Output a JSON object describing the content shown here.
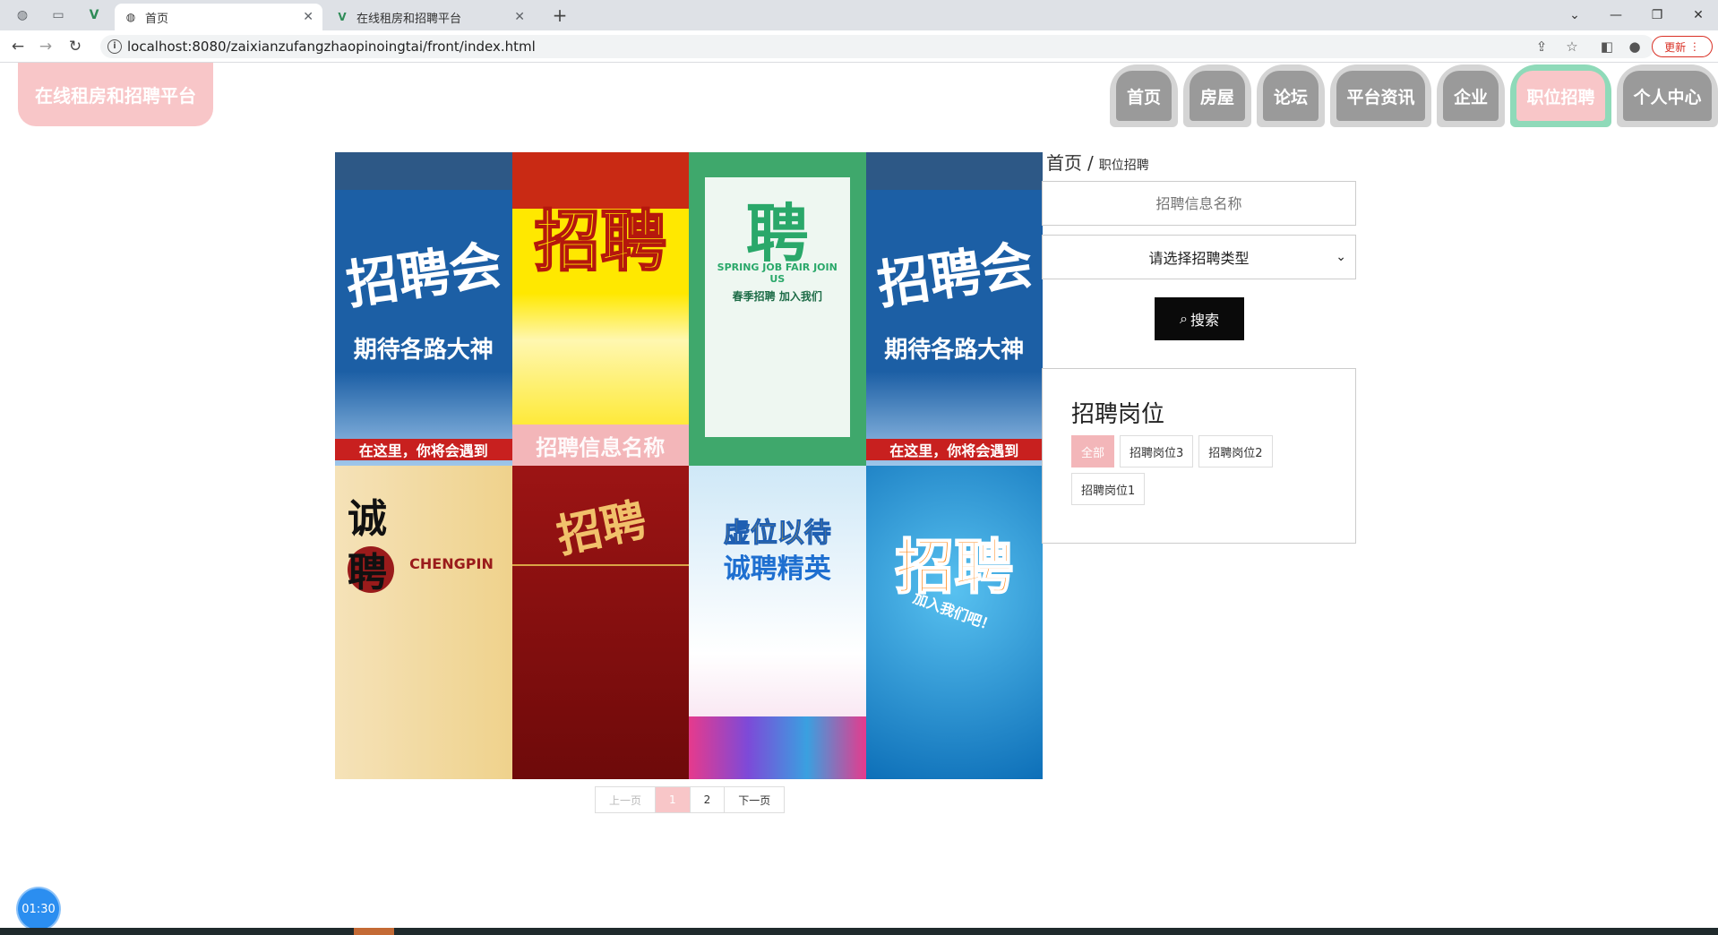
{
  "browser": {
    "tabs": [
      {
        "title": "首页",
        "active": true
      },
      {
        "title": "在线租房和招聘平台",
        "active": false
      }
    ],
    "url": "localhost:8080/zaixianzufangzhaopinoingtai/front/index.html",
    "update_label": "更新"
  },
  "site": {
    "logo": "在线租房和招聘平台",
    "nav": [
      "首页",
      "房屋",
      "论坛",
      "平台资讯",
      "企业",
      "职位招聘",
      "个人中心"
    ],
    "active_nav": "职位招聘"
  },
  "posters": [
    {
      "text": "招聘会",
      "sub": "期待各路大神",
      "banner": "在这里，你将会遇到",
      "color": "#1d5fa8",
      "text_color": "#ffffff",
      "caption": ""
    },
    {
      "text": "招聘",
      "sub": "",
      "banner": "",
      "color": "#f0d400",
      "text_color": "#ffe600",
      "caption": "招聘信息名称"
    },
    {
      "text": "聘",
      "sub": "SPRING JOB FAIR JOIN US",
      "banner": "春季招聘 加入我们",
      "color": "#dfeee6",
      "text_color": "#2aa86a",
      "caption": ""
    },
    {
      "text": "招聘会",
      "sub": "期待各路大神",
      "banner": "在这里，你将会遇到",
      "color": "#1d5fa8",
      "text_color": "#ffffff",
      "caption": ""
    },
    {
      "text": "诚聘",
      "sub": "CHENGPIN",
      "banner": "",
      "color": "#f1dfa5",
      "text_color": "#9a1b1b",
      "caption": ""
    },
    {
      "text": "招聘",
      "sub": "",
      "banner": "",
      "color": "#8f0f0f",
      "text_color": "#f1c16b",
      "caption": ""
    },
    {
      "text": "虚位以待",
      "sub": "诚聘精英",
      "banner": "",
      "color": "#dff1fb",
      "text_color": "#f2b21b",
      "caption": ""
    },
    {
      "text": "招聘",
      "sub": "加入我们吧！",
      "banner": "",
      "color": "#1b8fd8",
      "text_color": "#ff8a1d",
      "caption": ""
    }
  ],
  "pager": {
    "prev": "上一页",
    "pages": [
      "1",
      "2"
    ],
    "current": "1",
    "next": "下一页"
  },
  "breadcrumb": {
    "home": "首页",
    "sep": "/",
    "current": "职位招聘"
  },
  "search": {
    "placeholder": "招聘信息名称",
    "select_placeholder": "请选择招聘类型",
    "button": "搜索"
  },
  "categories": {
    "title": "招聘岗位",
    "items": [
      "全部",
      "招聘岗位3",
      "招聘岗位2",
      "招聘岗位1"
    ],
    "active": "全部"
  },
  "timer": "01:30"
}
